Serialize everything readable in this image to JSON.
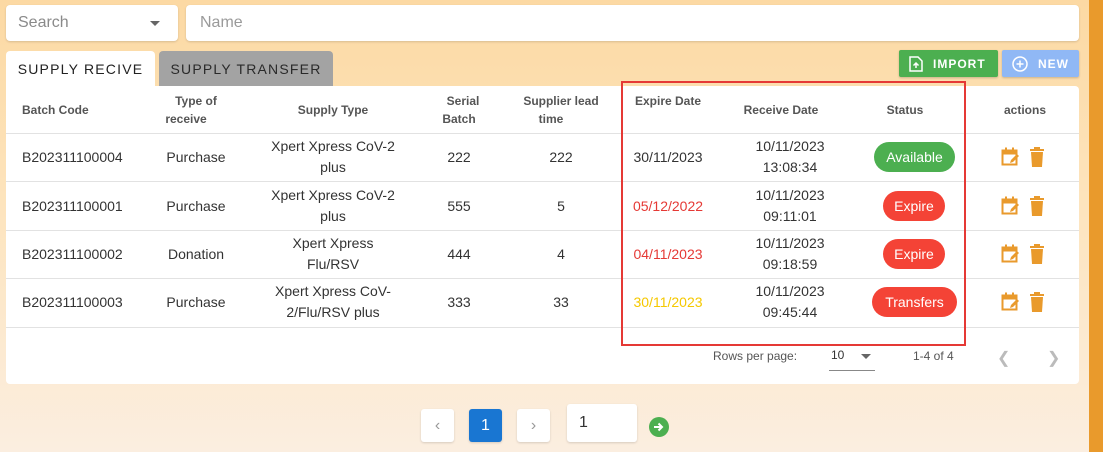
{
  "filters": {
    "search_placeholder": "Search",
    "name_placeholder": "Name"
  },
  "tabs": [
    {
      "label": "SUPPLY RECIVE",
      "active": true
    },
    {
      "label": "SUPPLY TRANSFER",
      "active": false
    }
  ],
  "toolbar": {
    "import_label": "IMPORT",
    "new_label": "NEW"
  },
  "table": {
    "headers": {
      "batch_code": "Batch Code",
      "type_of_receive": [
        "Type of",
        "receive"
      ],
      "supply_type": "Supply Type",
      "serial_batch": [
        "Serial",
        "Batch"
      ],
      "supplier_lead_time": [
        "Supplier lead",
        "time"
      ],
      "expire_date": "Expire Date",
      "receive_date": "Receive Date",
      "status": "Status",
      "actions": "actions"
    },
    "rows": [
      {
        "batch_code": "B202311100004",
        "type": "Purchase",
        "supply_type": [
          "Xpert Xpress CoV-2",
          "plus"
        ],
        "serial": "222",
        "lead_time": "222",
        "expire_date": "30/11/2023",
        "expire_color": "#333333",
        "receive_date": "10/11/2023",
        "receive_time": "13:08:34",
        "status": "Available",
        "status_color": "#4caf50"
      },
      {
        "batch_code": "B202311100001",
        "type": "Purchase",
        "supply_type": [
          "Xpert Xpress CoV-2",
          "plus"
        ],
        "serial": "555",
        "lead_time": "5",
        "expire_date": "05/12/2022",
        "expire_color": "#e53935",
        "receive_date": "10/11/2023",
        "receive_time": "09:11:01",
        "status": "Expire",
        "status_color": "#f44336"
      },
      {
        "batch_code": "B202311100002",
        "type": "Donation",
        "supply_type": [
          "Xpert Xpress",
          "Flu/RSV"
        ],
        "serial": "444",
        "lead_time": "4",
        "expire_date": "04/11/2023",
        "expire_color": "#e53935",
        "receive_date": "10/11/2023",
        "receive_time": "09:18:59",
        "status": "Expire",
        "status_color": "#f44336"
      },
      {
        "batch_code": "B202311100003",
        "type": "Purchase",
        "supply_type": [
          "Xpert Xpress CoV-",
          "2/Flu/RSV plus"
        ],
        "serial": "333",
        "lead_time": "33",
        "expire_date": "30/11/2023",
        "expire_color": "#f5c800",
        "receive_date": "10/11/2023",
        "receive_time": "09:45:44",
        "status": "Transfers",
        "status_color": "#f44336"
      }
    ]
  },
  "table_footer": {
    "rows_per_page_label": "Rows per page:",
    "rows_per_page_value": "10",
    "range": "1-4 of 4"
  },
  "pagination": {
    "current_page": "1",
    "goto_value": "1"
  },
  "colors": {
    "accent_orange": "#e99a2c",
    "primary_blue": "#1976d2",
    "green": "#4caf50",
    "red": "#f44336"
  }
}
